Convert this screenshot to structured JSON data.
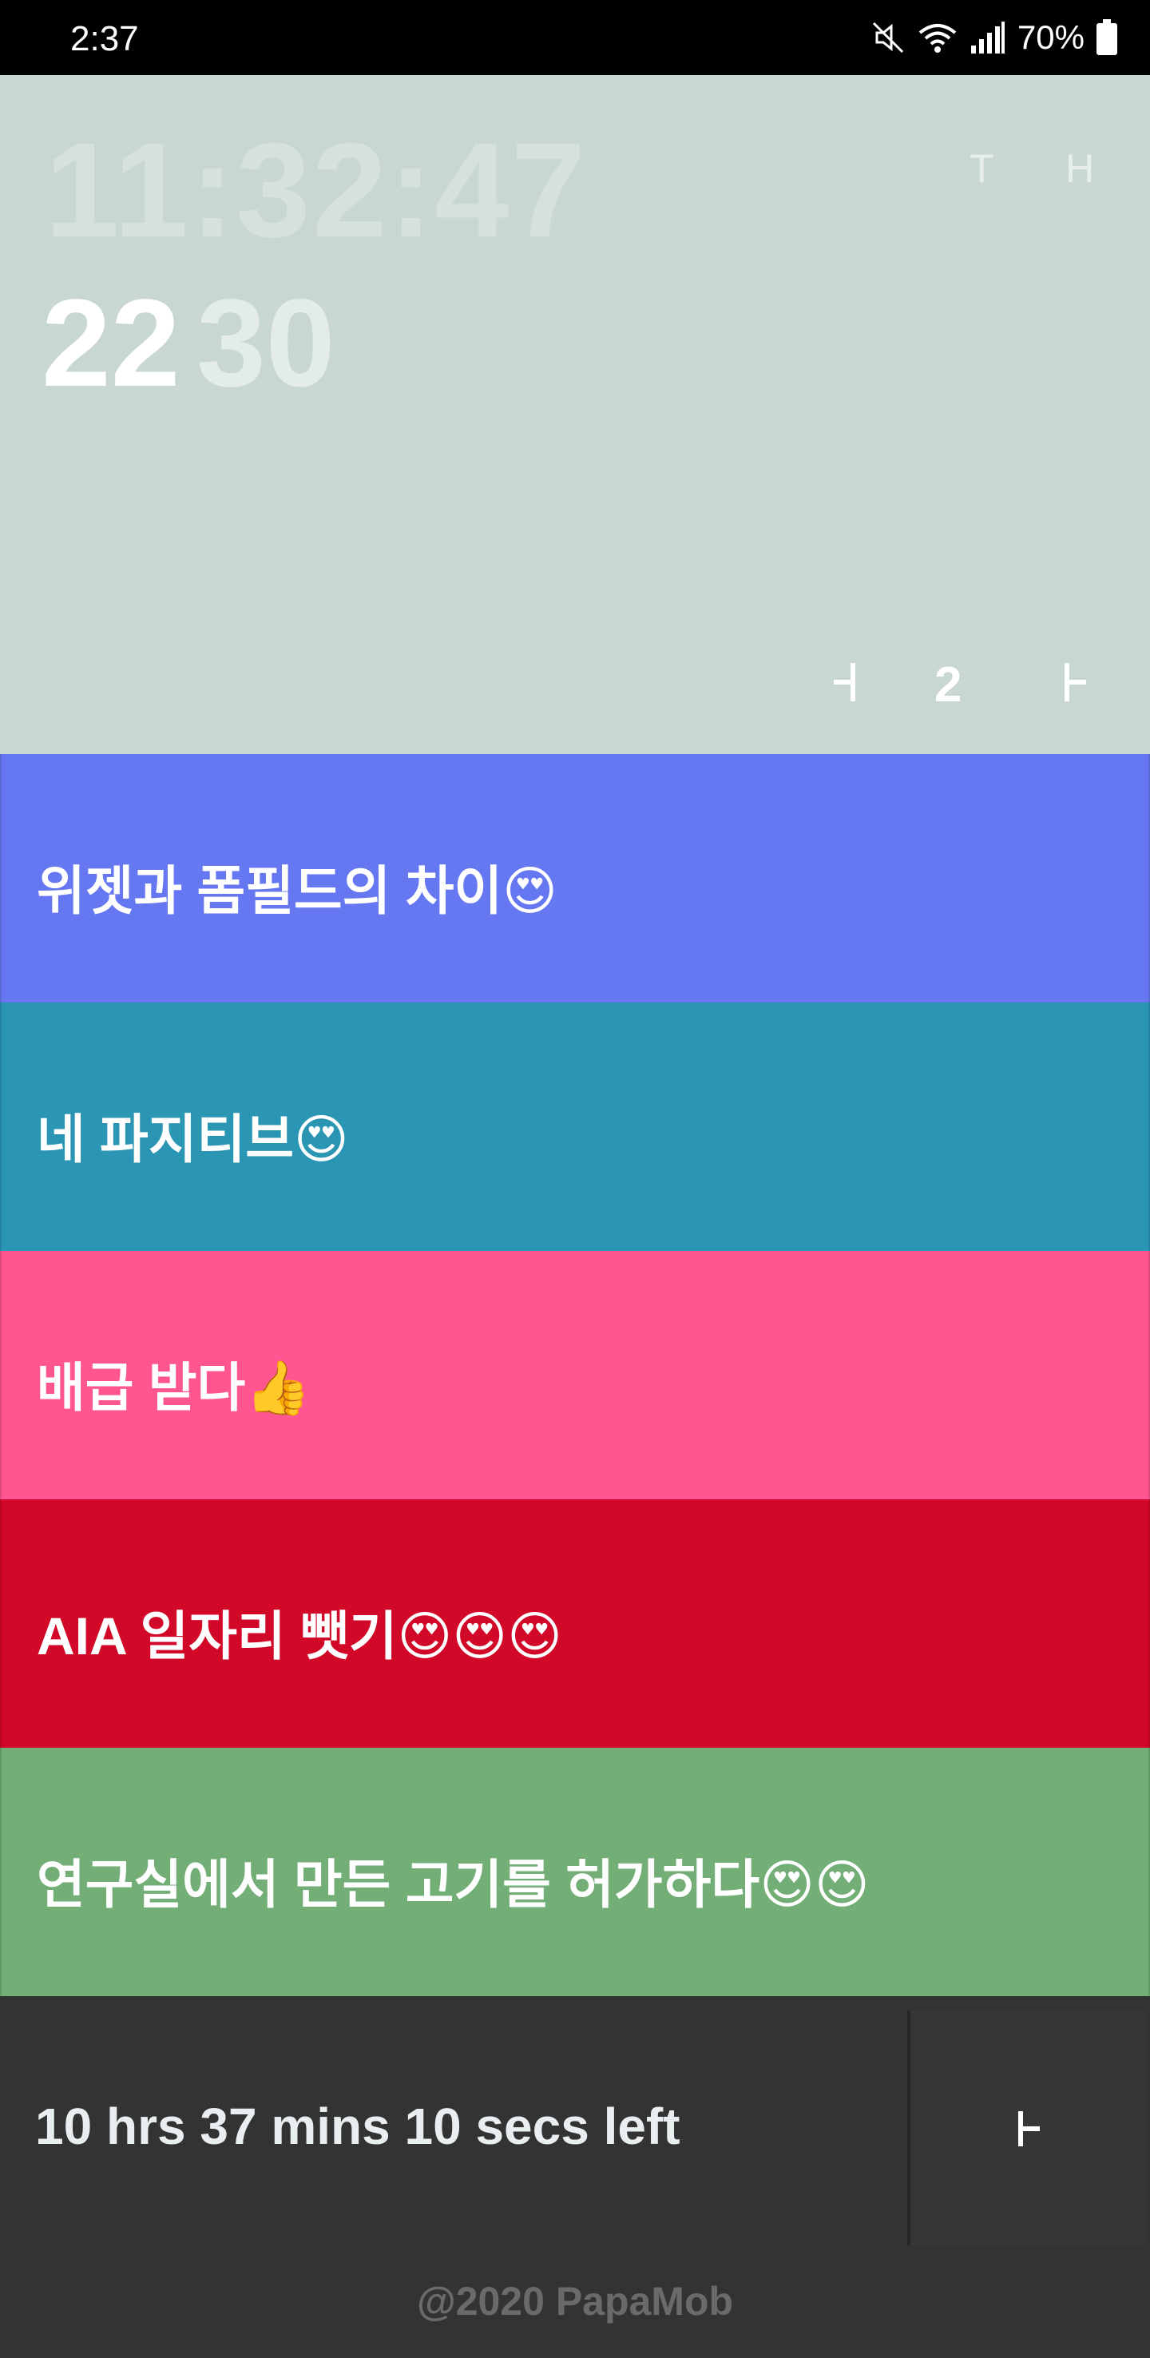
{
  "status_bar": {
    "time": "2:37",
    "battery_percent": "70%",
    "icons": [
      "mute-icon",
      "wifi-icon",
      "signal-icon",
      "battery-icon"
    ]
  },
  "header": {
    "clock": "11:32:47",
    "toggle_t": "T",
    "toggle_h": "H",
    "primary_number": "22",
    "secondary_number": "30",
    "pager": {
      "prev_icon": "prev-arrow-icon",
      "page": "2",
      "next_icon": "next-arrow-icon"
    }
  },
  "items": [
    {
      "label": "위젯과 폼필드의 차이😍",
      "color": "#6578f1"
    },
    {
      "label": "네 파지티브😍",
      "color": "#2b96b4"
    },
    {
      "label": "배급 받다👍",
      "color": "#ff5590"
    },
    {
      "label": "AIA 일자리 뺏기😍😍😍",
      "color": "#d10828"
    },
    {
      "label": "연구실에서 만든 고기를 허가하다😍😍",
      "color": "#72ae76"
    }
  ],
  "footer": {
    "countdown": "10 hrs 37 mins 10 secs left",
    "add_icon": "next-arrow-icon",
    "copyright": "@2020 PapaMob"
  },
  "colors": {
    "header_bg": "#c8d6d4",
    "footer_bg": "#333333"
  }
}
